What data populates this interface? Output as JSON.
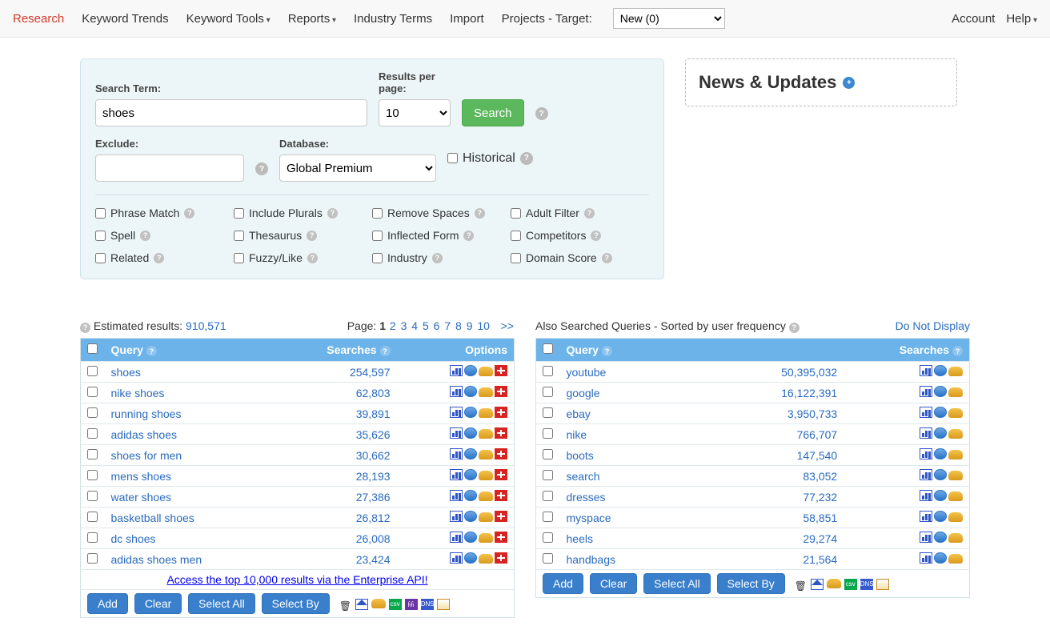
{
  "nav": {
    "research": "Research",
    "trends": "Keyword Trends",
    "tools": "Keyword Tools",
    "reports": "Reports",
    "industry": "Industry Terms",
    "import": "Import",
    "projects_label": "Projects - Target:",
    "project_selected": "New (0)",
    "account": "Account",
    "help": "Help"
  },
  "search": {
    "term_label": "Search Term:",
    "term_value": "shoes",
    "rpp_label": "Results per page:",
    "rpp_value": "10",
    "btn": "Search",
    "exclude_label": "Exclude:",
    "db_label": "Database:",
    "db_value": "Global Premium",
    "historical_label": "Historical",
    "checks": {
      "phrase": "Phrase Match",
      "plurals": "Include Plurals",
      "spaces": "Remove Spaces",
      "adult": "Adult Filter",
      "spell": "Spell",
      "thes": "Thesaurus",
      "infl": "Inflected Form",
      "comp": "Competitors",
      "related": "Related",
      "fuzzy": "Fuzzy/Like",
      "industry": "Industry",
      "domain": "Domain Score"
    }
  },
  "news": {
    "title": "News & Updates"
  },
  "results": {
    "est_label": "Estimated results: ",
    "est_value": "910,571",
    "page_label": "Page: ",
    "page_current": "1",
    "pages": [
      "2",
      "3",
      "4",
      "5",
      "6",
      "7",
      "8",
      "9",
      "10"
    ],
    "page_next": ">>",
    "th_query": "Query",
    "th_searches": "Searches",
    "th_options": "Options",
    "rows": [
      {
        "q": "shoes",
        "s": "254,597"
      },
      {
        "q": "nike shoes",
        "s": "62,803"
      },
      {
        "q": "running shoes",
        "s": "39,891"
      },
      {
        "q": "adidas shoes",
        "s": "35,626"
      },
      {
        "q": "shoes for men",
        "s": "30,662"
      },
      {
        "q": "mens shoes",
        "s": "28,193"
      },
      {
        "q": "water shoes",
        "s": "27,386"
      },
      {
        "q": "basketball shoes",
        "s": "26,812"
      },
      {
        "q": "dc shoes",
        "s": "26,008"
      },
      {
        "q": "adidas shoes men",
        "s": "23,424"
      }
    ],
    "ent_link": "Access the top 10,000 results via the Enterprise API!",
    "btn_add": "Add",
    "btn_clear": "Clear",
    "btn_selall": "Select All",
    "btn_selby": "Select By"
  },
  "also": {
    "label": "Also Searched Queries - Sorted by user frequency ",
    "dnd": "Do Not Display",
    "th_query": "Query",
    "th_searches": "Searches",
    "rows": [
      {
        "q": "youtube",
        "s": "50,395,032"
      },
      {
        "q": "google",
        "s": "16,122,391"
      },
      {
        "q": "ebay",
        "s": "3,950,733"
      },
      {
        "q": "nike",
        "s": "766,707"
      },
      {
        "q": "boots",
        "s": "147,540"
      },
      {
        "q": "search",
        "s": "83,052"
      },
      {
        "q": "dresses",
        "s": "77,232"
      },
      {
        "q": "myspace",
        "s": "58,851"
      },
      {
        "q": "heels",
        "s": "29,274"
      },
      {
        "q": "handbags",
        "s": "21,564"
      }
    ],
    "btn_add": "Add",
    "btn_clear": "Clear",
    "btn_selall": "Select All",
    "btn_selby": "Select By"
  }
}
